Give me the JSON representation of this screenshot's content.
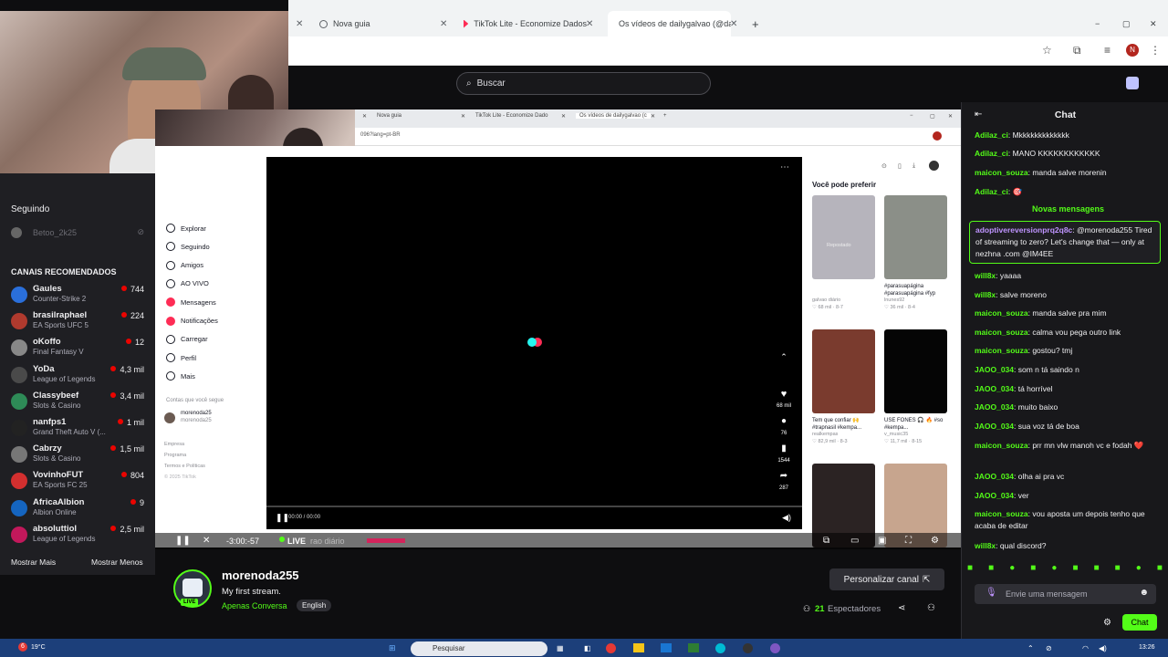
{
  "outer_browser": {
    "tabs": [
      {
        "label": "Nova guia"
      },
      {
        "label": "TikTok Lite - Economize Dados"
      },
      {
        "label": "Os vídeos de dailygalvao (@da..."
      }
    ],
    "new_tab": "+",
    "window_controls": [
      "−",
      "▢",
      "✕"
    ],
    "profile_initial": "N"
  },
  "site": {
    "search_placeholder": "Buscar"
  },
  "webcam": {
    "label": ""
  },
  "sidebar": {
    "following_heading": "Seguindo",
    "followed_channel": "Betoo_2k25",
    "recommended_heading": "CANAIS RECOMENDADOS",
    "channels": [
      {
        "name": "Gaules",
        "game": "Counter-Strike 2",
        "viewers": "744",
        "color": "#2a6fdb"
      },
      {
        "name": "brasilraphael",
        "game": "EA Sports UFC 5",
        "viewers": "224",
        "color": "#b03a2e"
      },
      {
        "name": "oKoffo",
        "game": "Final Fantasy V",
        "viewers": "12",
        "color": "#888"
      },
      {
        "name": "YoDa",
        "game": "League of Legends",
        "viewers": "4,3 mil",
        "color": "#4a4a4a"
      },
      {
        "name": "Classybeef",
        "game": "Slots & Casino",
        "viewers": "3,4 mil",
        "color": "#2e8b57"
      },
      {
        "name": "nanfps1",
        "game": "Grand Theft Auto V (...",
        "viewers": "1 mil",
        "color": "#222"
      },
      {
        "name": "Cabrzy",
        "game": "Slots & Casino",
        "viewers": "1,5 mil",
        "color": "#777"
      },
      {
        "name": "VovinhoFUT",
        "game": "EA Sports FC 25",
        "viewers": "804",
        "color": "#d32f2f"
      },
      {
        "name": "AfricaAlbion",
        "game": "Albion Online",
        "viewers": "9",
        "color": "#1565c0"
      },
      {
        "name": "absoluttiol",
        "game": "League of Legends",
        "viewers": "2,5 mil",
        "color": "#c2185b"
      }
    ],
    "show_more": "Mostrar Mais",
    "show_less": "Mostrar Menos"
  },
  "inner_browser": {
    "tabs": [
      {
        "label": "Nova guia"
      },
      {
        "label": "TikTok Lite - Economize Dado"
      },
      {
        "label": "Os vídeos de dailygalvao (c"
      }
    ],
    "url": "096?lang=pt-BR"
  },
  "tiktok": {
    "nav": [
      {
        "label": "Explorar",
        "icon": "compass-icon"
      },
      {
        "label": "Seguindo",
        "icon": "following-icon"
      },
      {
        "label": "Amigos",
        "icon": "friends-icon"
      },
      {
        "label": "AO VIVO",
        "icon": "live-icon"
      },
      {
        "label": "Mensagens",
        "icon": "messages-icon"
      },
      {
        "label": "Notificações",
        "icon": "bell-icon"
      },
      {
        "label": "Carregar",
        "icon": "upload-icon"
      },
      {
        "label": "Perfil",
        "icon": "profile-icon"
      },
      {
        "label": "Mais",
        "icon": "more-icon"
      }
    ],
    "following_accounts_heading": "Contas que você segue",
    "followed_account": "morenoda25",
    "followed_account_sub": "morenoda25",
    "footer": [
      "Empresa",
      "Programa",
      "Termos e Políticas",
      "© 2025 TikTok"
    ],
    "player": {
      "time": "00:00 / 00:00",
      "likes": "68 mil",
      "comments": "76",
      "saves": "1544",
      "shares": "287"
    },
    "rec_heading": "Você pode preferir",
    "recs": [
      {
        "caption": "",
        "author": "galvao diário",
        "stats": "♡ 68 mil · 8-7",
        "bg": "#b6b4bc"
      },
      {
        "caption": "#parasuapágina #parasuapágina #fyp",
        "author": "lnunes92",
        "stats": "♡ 36 mil · 8-4",
        "bg": "#8b8f88"
      },
      {
        "caption": "Tem que confiar 🙌 #trapnasil #kempa...",
        "author": "realkempas",
        "stats": "♡ 82,9 mil · 8-3",
        "bg": "#7a3b2e"
      },
      {
        "caption": "USE FONES 🎧 🔥 #so #kempa...",
        "author": "v_music35",
        "stats": "♡ 11,7 mil · 8-15",
        "bg": "#050505"
      },
      {
        "caption": "",
        "author": "",
        "stats": "",
        "bg": "#2b2323"
      },
      {
        "caption": "",
        "author": "",
        "stats": "",
        "bg": "#c7a58e"
      }
    ],
    "repost_label": "Repostado"
  },
  "stream_controls": {
    "time": "-3:00:-57",
    "live": "LIVE",
    "ticker": "rao diário"
  },
  "channel_info": {
    "name": "morenoda255",
    "title": "My first stream.",
    "category": "Apenas Conversa",
    "tag": "English",
    "live_badge": "LIVE",
    "viewers": "21",
    "viewers_label": "Espectadores",
    "customize_button": "Personalizar canal"
  },
  "chat": {
    "title": "Chat",
    "new_messages": "Novas mensagens",
    "messages": [
      {
        "user": "Adilaz_ci",
        "color": "#53fc18",
        "text": "Mkkkkkkkkkkkkk"
      },
      {
        "user": "Adilaz_ci",
        "color": "#53fc18",
        "text": "MANO KKKKKKKKKKKK"
      },
      {
        "user": "maicon_souza",
        "color": "#53fc18",
        "text": "manda salve morenin"
      },
      {
        "user": "Adilaz_ci",
        "color": "#53fc18",
        "text": "🎯"
      },
      {
        "user": "adoptivereversionprq2q8c",
        "color": "#bf94ff",
        "text": "@morenoda255 Tired of streaming to zero? Let's change that — only at nezhna .com @IM4EE"
      },
      {
        "user": "will8x",
        "color": "#53fc18",
        "text": "yaaaa"
      },
      {
        "user": "will8x",
        "color": "#53fc18",
        "text": "salve moreno"
      },
      {
        "user": "maicon_souza",
        "color": "#53fc18",
        "text": "manda salve pra mim"
      },
      {
        "user": "maicon_souza",
        "color": "#53fc18",
        "text": "calma vou pega outro link"
      },
      {
        "user": "maicon_souza",
        "color": "#53fc18",
        "text": "gostou? tmj"
      },
      {
        "user": "JAOO_034",
        "color": "#53fc18",
        "text": "som n tá saindo n"
      },
      {
        "user": "JAOO_034",
        "color": "#53fc18",
        "text": "tá horrível"
      },
      {
        "user": "JAOO_034",
        "color": "#53fc18",
        "text": "muito baixo"
      },
      {
        "user": "JAOO_034",
        "color": "#53fc18",
        "text": "sua voz tá de boa"
      },
      {
        "user": "maicon_souza",
        "color": "#53fc18",
        "text": "prr mn vlw manoh vc e fodah ❤️"
      },
      {
        "user": "JAOO_034",
        "color": "#53fc18",
        "text": "olha ai pra vc"
      },
      {
        "user": "JAOO_034",
        "color": "#53fc18",
        "text": "ver"
      },
      {
        "user": "maicon_souza",
        "color": "#53fc18",
        "text": "vou aposta um depois tenho que acaba de editar"
      },
      {
        "user": "will8x",
        "color": "#53fc18",
        "text": "qual discord?"
      }
    ],
    "input_placeholder": "Envie uma mensagem",
    "send_button": "Chat"
  },
  "taskbar": {
    "temp": "19°C",
    "search": "Pesquisar",
    "clock": "13:26",
    "notif_count": "6"
  }
}
